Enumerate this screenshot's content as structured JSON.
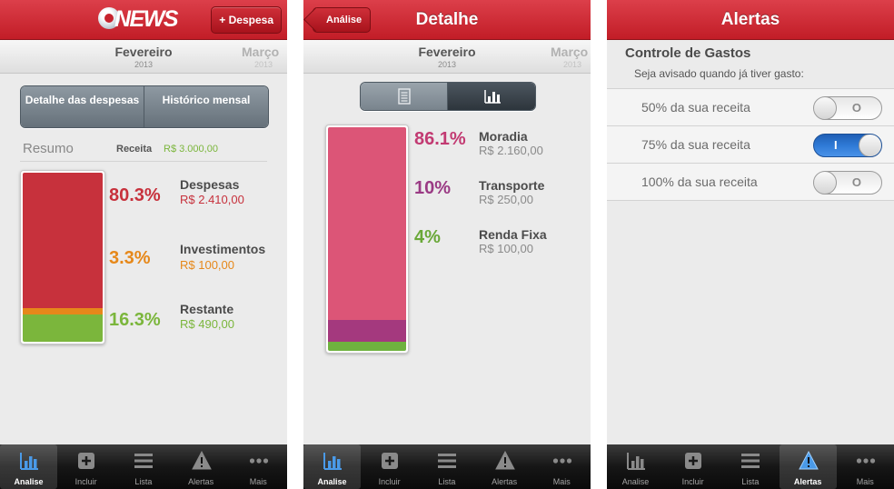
{
  "screen1": {
    "logo_text": "NEWS",
    "add_button": "+ Despesa",
    "month_current": "Fevereiro",
    "month_current_year": "2013",
    "month_next": "Março",
    "month_next_year": "2013",
    "seg_left": "Detalhe das despesas",
    "seg_right": "Histórico mensal",
    "resumo_label": "Resumo",
    "receita_label": "Receita",
    "receita_value": "R$ 3.000,00",
    "items": [
      {
        "pct": "80.3%",
        "name": "Despesas",
        "value": "R$ 2.410,00",
        "color": "#c7313c",
        "fraction": 0.803
      },
      {
        "pct": "3.3%",
        "name": "Investimentos",
        "value": "R$ 100,00",
        "color": "#e6881a",
        "fraction": 0.033
      },
      {
        "pct": "16.3%",
        "name": "Restante",
        "value": "R$ 490,00",
        "color": "#7bb63c",
        "fraction": 0.163
      }
    ]
  },
  "screen2": {
    "back_button": "Análise",
    "title": "Detalhe",
    "month_current": "Fevereiro",
    "month_current_year": "2013",
    "month_next": "Março",
    "month_next_year": "2013",
    "items": [
      {
        "pct": "86.1%",
        "name": "Moradia",
        "value": "R$ 2.160,00",
        "color": "#dc5577",
        "pct_color": "#c23a72",
        "fraction": 0.861
      },
      {
        "pct": "10%",
        "name": "Transporte",
        "value": "R$ 250,00",
        "color": "#a4397e",
        "pct_color": "#9a3a84",
        "fraction": 0.1
      },
      {
        "pct": "4%",
        "name": "Renda Fixa",
        "value": "R$ 100,00",
        "color": "#6fb23f",
        "pct_color": "#6aa838",
        "fraction": 0.04
      }
    ]
  },
  "screen3": {
    "title": "Alertas",
    "section_title": "Controle de Gastos",
    "section_subtitle": "Seja avisado quando já tiver gasto:",
    "alerts": [
      {
        "label": "50% da sua receita",
        "on": false,
        "mark": "O"
      },
      {
        "label": "75% da sua receita",
        "on": true,
        "mark": "I"
      },
      {
        "label": "100% da sua receita",
        "on": false,
        "mark": "O"
      }
    ]
  },
  "tabs": [
    "Analise",
    "Incluir",
    "Lista",
    "Alertas",
    "Mais"
  ],
  "colors": {
    "brand_red": "#c8232d",
    "toggle_on": "#2f7ad6"
  }
}
